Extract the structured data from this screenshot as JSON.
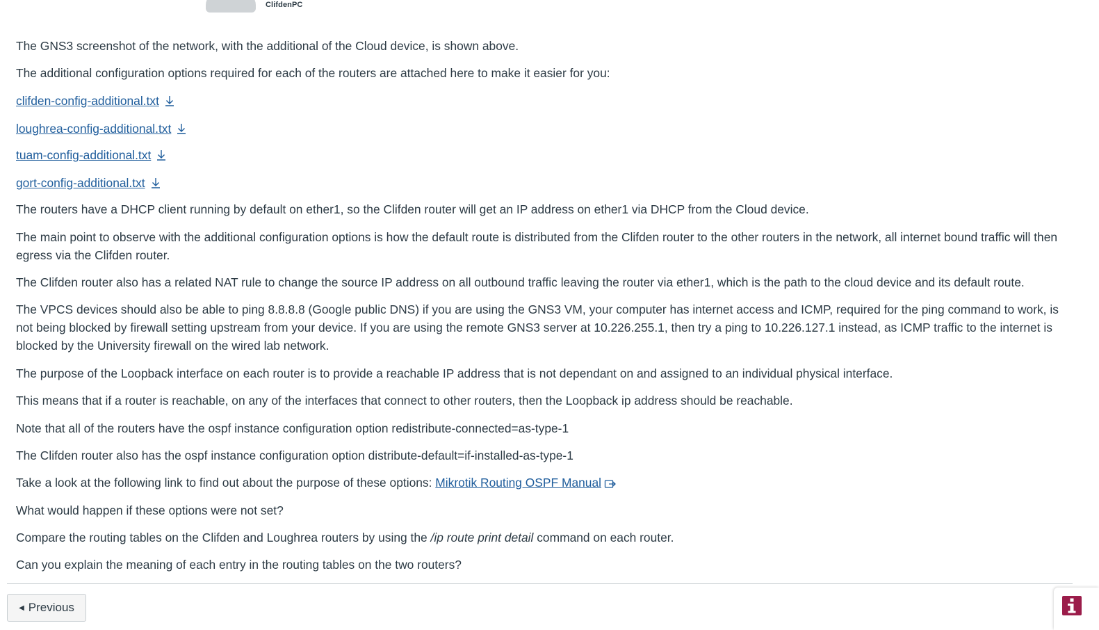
{
  "header": {
    "device_label": "ClifdenPC"
  },
  "content": {
    "p1": "The GNS3 screenshot of the network, with the additional of the Cloud device, is shown above.",
    "p2": "The additional configuration options required for each of the routers are attached here to make it easier for you:",
    "files": [
      {
        "label": "clifden-config-additional.txt",
        "icon": "download-icon"
      },
      {
        "label": "loughrea-config-additional.txt",
        "icon": "download-icon"
      },
      {
        "label": "tuam-config-additional.txt",
        "icon": "download-icon"
      },
      {
        "label": "gort-config-additional.txt",
        "icon": "download-icon"
      }
    ],
    "p3": "The routers have a DHCP client running by default on ether1, so the Clifden router will get an IP address on ether1 via DHCP from the Cloud device.",
    "p4": "The main point to observe with the additional configuration options is how the default route is distributed from the Clifden router to the other routers in the network, all internet bound traffic will then egress via the Clifden router.",
    "p5": "The Clifden router also has a related NAT rule to change the source IP address on all outbound traffic leaving the router via ether1, which is the path to the cloud device and its default route.",
    "p6": "The VPCS devices should also be able to ping 8.8.8.8 (Google public DNS) if you are using the GNS3 VM, your computer has internet access and ICMP, required for the ping command to work, is not being blocked by firewall setting upstream from your device. If you are using the remote GNS3 server at 10.226.255.1, then try a ping to 10.226.127.1 instead, as ICMP traffic to the internet is blocked by the University firewall on the wired lab network.",
    "p7": "The purpose of the Loopback interface on each router is to provide a reachable IP address that is not dependant on and assigned to an individual physical interface.",
    "p8": "This means that if a router is reachable, on any of the interfaces that connect to other routers, then the Loopback ip address should be reachable.",
    "p9": "Note that all of the routers have the ospf instance configuration option redistribute-connected=as-type-1",
    "p10": "The Clifden router also has the ospf instance configuration option distribute-default=if-installed-as-type-1",
    "p11_prefix": "Take a look at the following link to find out about the purpose of these options: ",
    "p11_link": "Mikrotik Routing OSPF Manual",
    "p12": "What would happen if these options were not set?",
    "p13_prefix": "Compare the routing tables on the Clifden and Loughrea routers by using the ",
    "p13_cmd": "/ip route print detail",
    "p13_suffix": " command on each router.",
    "p14": "Can you explain the meaning of each entry in the routing tables on the two routers?"
  },
  "footer": {
    "previous_label": "Previous",
    "info_icon": "info-icon"
  },
  "colors": {
    "text": "#2d3b45",
    "link": "#1f5d9c",
    "info_badge": "#9b1c4a"
  }
}
